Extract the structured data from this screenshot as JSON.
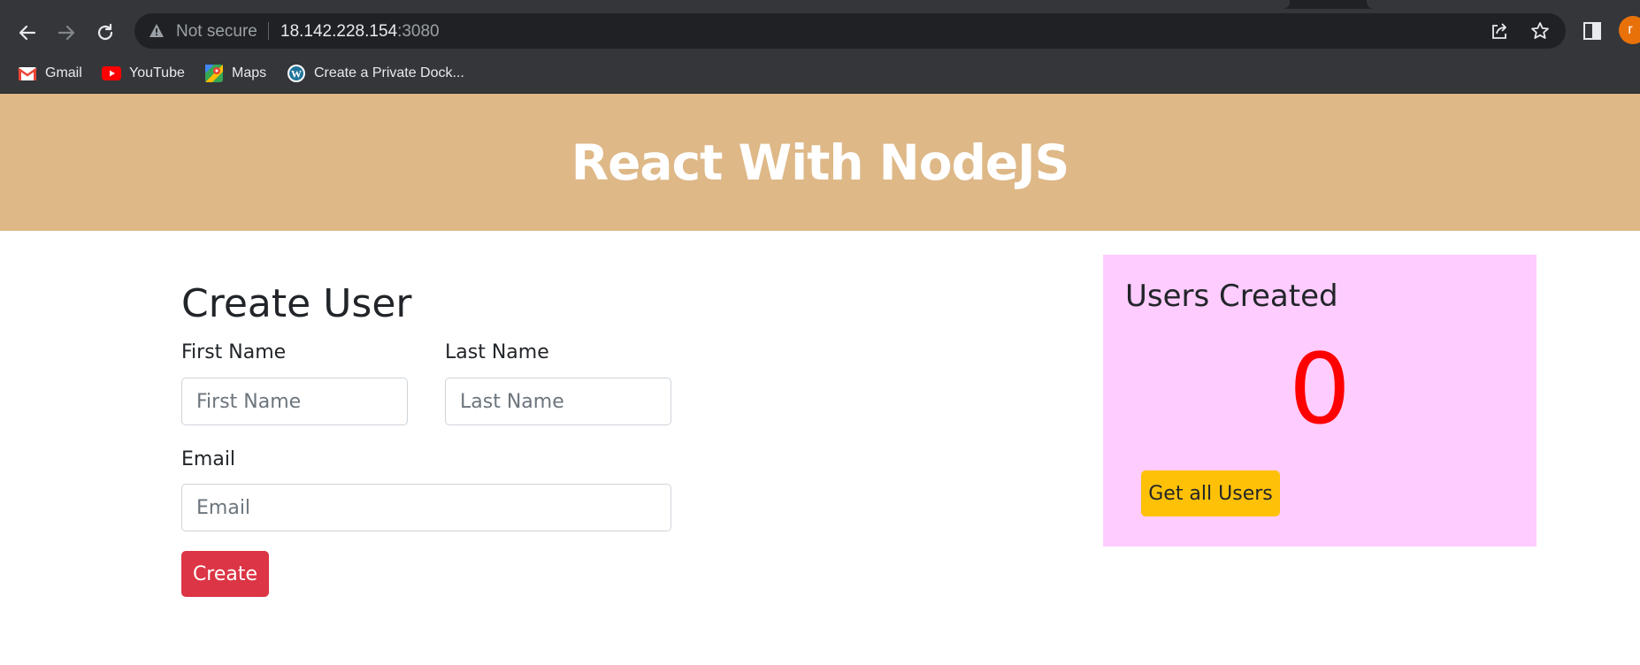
{
  "browser": {
    "security_label": "Not secure",
    "url_host": "18.142.228.154",
    "url_port": ":3080",
    "profile_initial": "r",
    "bookmarks": [
      {
        "label": "Gmail",
        "icon": "gmail-icon"
      },
      {
        "label": "YouTube",
        "icon": "youtube-icon"
      },
      {
        "label": "Maps",
        "icon": "maps-icon"
      },
      {
        "label": "Create a Private Dock...",
        "icon": "wordpress-icon"
      }
    ]
  },
  "header": {
    "title": "React With NodeJS",
    "background": "#deb887"
  },
  "form": {
    "title": "Create User",
    "first_name_label": "First Name",
    "first_name_placeholder": "First Name",
    "first_name_value": "",
    "last_name_label": "Last Name",
    "last_name_placeholder": "Last Name",
    "last_name_value": "",
    "email_label": "Email",
    "email_placeholder": "Email",
    "email_value": "",
    "create_label": "Create",
    "create_color": "#dc3545"
  },
  "users_panel": {
    "title": "Users Created",
    "count": "0",
    "count_color": "#ff0000",
    "button_label": "Get all Users",
    "button_color": "#ffc107",
    "background": "#ffccff"
  }
}
